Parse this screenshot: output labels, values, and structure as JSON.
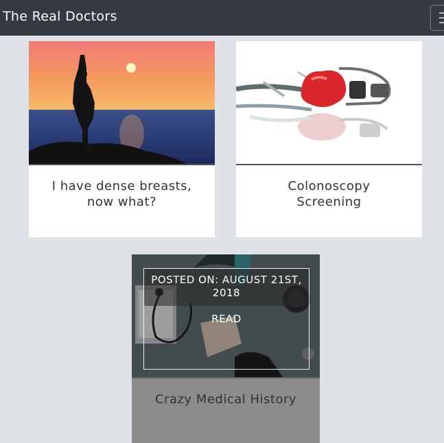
{
  "navbar": {
    "brand": "The Real Doctors",
    "toggle_icon": "hamburger-icon"
  },
  "posts": [
    {
      "title_line1": "I have dense breasts,",
      "title_line2": "now what?",
      "image": "yoga-sunset-image"
    },
    {
      "title_line1": "Colonoscopy",
      "title_line2": "Screening",
      "image": "stethoscope-heart-image"
    },
    {
      "title": "Crazy Medical History",
      "image": "doctor-patient-desk-image",
      "posted_on": "POSTED ON: AUGUST 21ST, 2018",
      "read_label": "READ"
    }
  ],
  "colors": {
    "navbar_bg": "#343a40",
    "page_bg": "#dfe3e8",
    "hovered_card_bg": "#8c8c8c"
  }
}
